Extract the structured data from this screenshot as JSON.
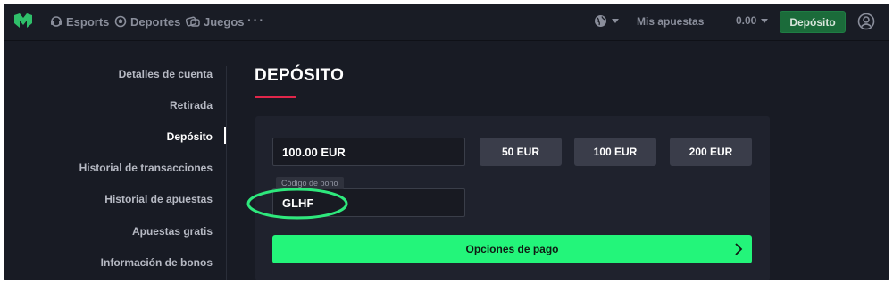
{
  "topbar": {
    "nav": [
      {
        "label": "Esports",
        "icon": "headset-icon"
      },
      {
        "label": "Deportes",
        "icon": "ball-icon"
      },
      {
        "label": "Juegos",
        "icon": "gamepad-icon"
      }
    ],
    "more_label": "···",
    "my_bets_label": "Mis apuestas",
    "balance": "0.00",
    "deposit_label": "Depósito"
  },
  "sidebar": {
    "items": [
      {
        "label": "Detalles de cuenta"
      },
      {
        "label": "Retirada"
      },
      {
        "label": "Depósito",
        "active": true
      },
      {
        "label": "Historial de transacciones"
      },
      {
        "label": "Historial de apuestas"
      },
      {
        "label": "Apuestas gratis"
      },
      {
        "label": "Información de bonos"
      }
    ]
  },
  "main": {
    "title": "DEPÓSITO",
    "amount_value": "100.00 EUR",
    "quick_amounts": [
      "50 EUR",
      "100 EUR",
      "200 EUR"
    ],
    "bonus_label": "Código de bono",
    "bonus_value": "GLHF",
    "payment_button_label": "Opciones de pago"
  },
  "colors": {
    "background": "#181b24",
    "accent_green": "#23f57a",
    "deposit_button": "#1b6b3a",
    "title_underline": "#e0264a",
    "highlight_ellipse": "#2ee87c"
  }
}
